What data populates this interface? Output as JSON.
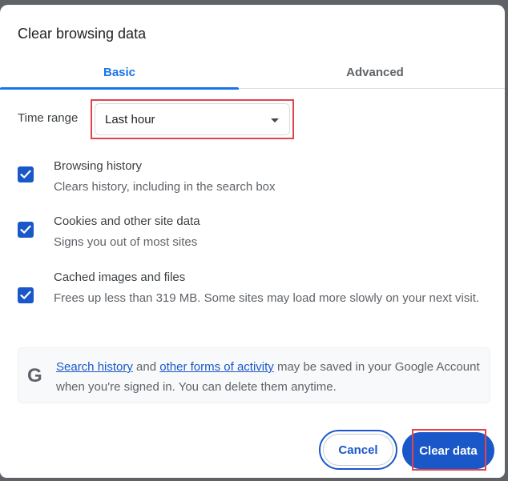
{
  "dialog": {
    "title": "Clear browsing data"
  },
  "tabs": [
    {
      "label": "Basic",
      "active": true
    },
    {
      "label": "Advanced",
      "active": false
    }
  ],
  "time_range": {
    "label": "Time range",
    "value": "Last hour"
  },
  "options": [
    {
      "title": "Browsing history",
      "description": "Clears history, including in the search box",
      "checked": true
    },
    {
      "title": "Cookies and other site data",
      "description": "Signs you out of most sites",
      "checked": true
    },
    {
      "title": "Cached images and files",
      "description": "Frees up less than 319 MB. Some sites may load more slowly on your next visit.",
      "checked": true
    }
  ],
  "info": {
    "icon": "google-g-icon",
    "link1": "Search history",
    "text1": " and ",
    "link2": "other forms of activity",
    "text2": " may be saved in your Google Account when you're signed in. You can delete them anytime."
  },
  "buttons": {
    "cancel": "Cancel",
    "clear": "Clear data"
  },
  "colors": {
    "accent": "#1a57c8",
    "tab_active": "#1a73e8",
    "highlight": "#e0454d"
  }
}
